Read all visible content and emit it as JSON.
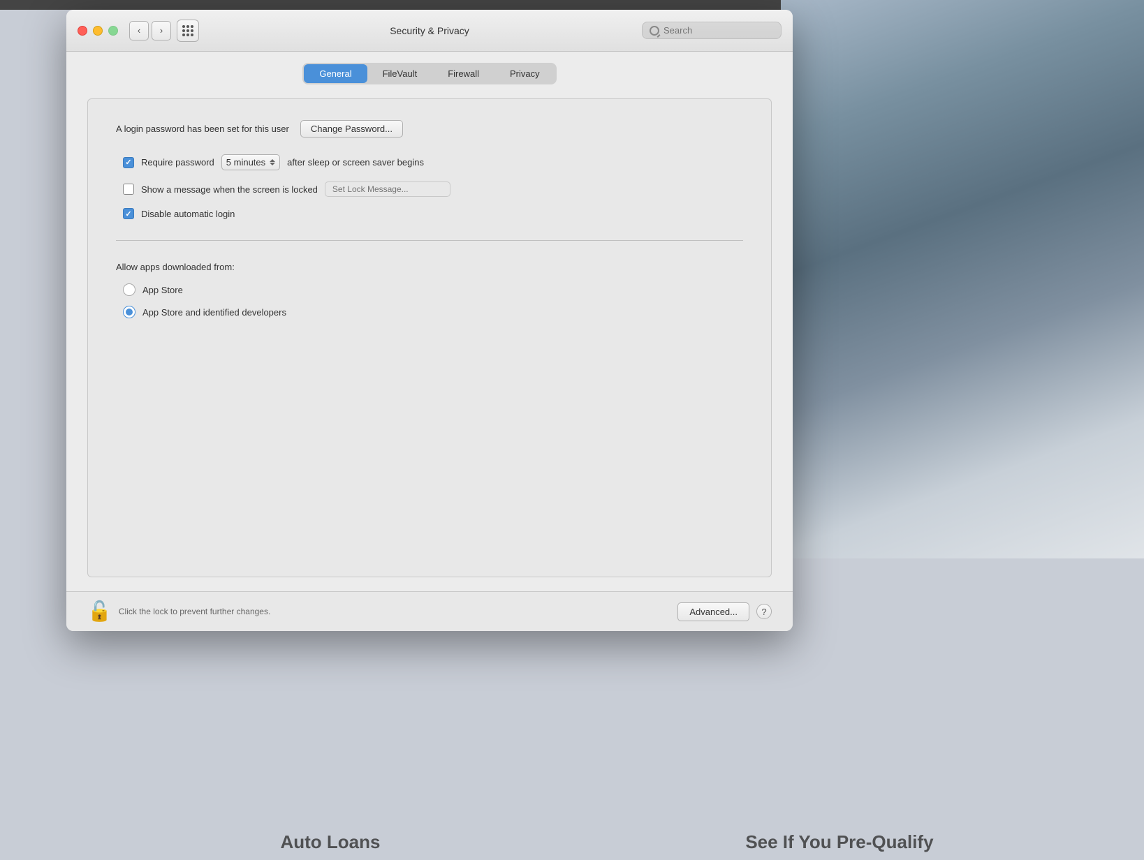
{
  "window": {
    "title": "Security & Privacy",
    "traffic_lights": {
      "close": "close",
      "minimize": "minimize",
      "maximize": "maximize"
    },
    "nav": {
      "back_label": "‹",
      "forward_label": "›"
    },
    "search": {
      "placeholder": "Search"
    }
  },
  "tabs": [
    {
      "id": "general",
      "label": "General",
      "active": true
    },
    {
      "id": "filevault",
      "label": "FileVault",
      "active": false
    },
    {
      "id": "firewall",
      "label": "Firewall",
      "active": false
    },
    {
      "id": "privacy",
      "label": "Privacy",
      "active": false
    }
  ],
  "general": {
    "password_label": "A login password has been set for this user",
    "change_password_btn": "Change Password...",
    "options": [
      {
        "id": "require-password",
        "checked": true,
        "label_before": "Require password",
        "select_value": "5 minutes",
        "label_after": "after sleep or screen saver begins",
        "has_select": true
      },
      {
        "id": "show-lock-message",
        "checked": false,
        "label_before": "Show a message when the screen is locked",
        "placeholder": "Set Lock Message...",
        "has_lock_input": true
      },
      {
        "id": "disable-auto-login",
        "checked": true,
        "label_before": "Disable automatic login"
      }
    ],
    "allow_apps": {
      "label": "Allow apps downloaded from:",
      "options": [
        {
          "id": "app-store",
          "label": "App Store",
          "selected": false
        },
        {
          "id": "app-store-identified",
          "label": "App Store and identified developers",
          "selected": true
        }
      ]
    },
    "footer": {
      "lock_message": "Click the lock to prevent further changes.",
      "advanced_btn": "Advanced...",
      "help_btn": "?"
    }
  },
  "bottom_text": {
    "left": "Auto Loans",
    "right": "See If You Pre-Qualify"
  }
}
